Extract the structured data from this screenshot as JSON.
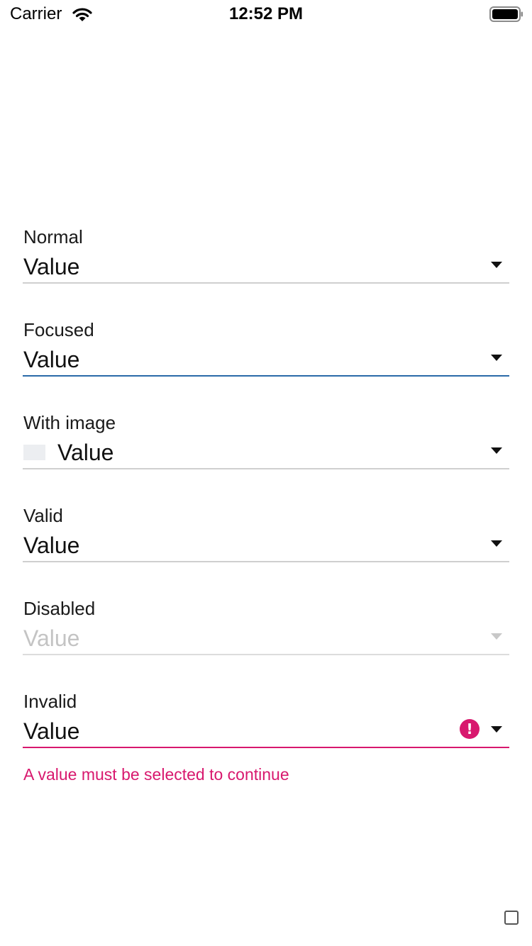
{
  "status_bar": {
    "carrier": "Carrier",
    "time": "12:52 PM",
    "wifi_icon": "wifi-icon",
    "battery_icon": "battery-icon"
  },
  "fields": {
    "normal": {
      "label": "Normal",
      "value": "Value",
      "state": "normal"
    },
    "focused": {
      "label": "Focused",
      "value": "Value",
      "state": "focused"
    },
    "with_image": {
      "label": "With image",
      "value": "Value",
      "state": "normal",
      "image": "placeholder-image"
    },
    "valid": {
      "label": "Valid",
      "value": "Value",
      "state": "valid"
    },
    "disabled": {
      "label": "Disabled",
      "value": "Value",
      "state": "disabled"
    },
    "invalid": {
      "label": "Invalid",
      "value": "Value",
      "state": "invalid",
      "error_icon": "!",
      "error_message": "A value must be selected to continue"
    }
  },
  "colors": {
    "focus_underline": "#2a6aa8",
    "error": "#d8186e",
    "disabled_text": "#c4c4c4",
    "default_underline": "#cfcfcf"
  }
}
